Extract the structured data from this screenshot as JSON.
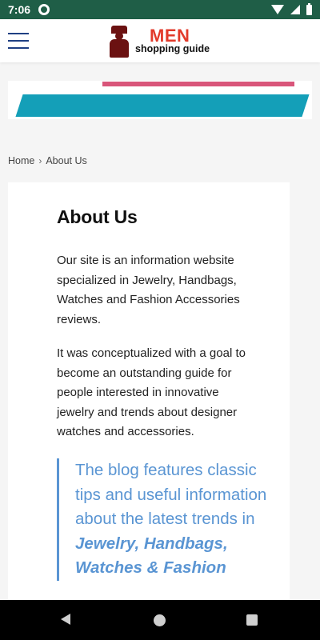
{
  "status_bar": {
    "time": "7:06",
    "icons": [
      "gear-icon",
      "wifi-icon",
      "cell-signal-icon",
      "battery-icon"
    ]
  },
  "header": {
    "logo_title": "MEN",
    "logo_subtitle": "shopping guide",
    "menu_icon": "hamburger-icon"
  },
  "colors": {
    "status_bar": "#1f5e47",
    "banner_pink": "#d9557a",
    "banner_teal": "#149fb8",
    "quote_accent": "#5a95d3",
    "menu_icon": "#1f3f83",
    "logo_red": "#e23a2a"
  },
  "breadcrumb": {
    "home": "Home",
    "separator": "›",
    "current": "About Us"
  },
  "content": {
    "title": "About Us",
    "paragraph1": "Our site is an information website specialized in Jewelry, Handbags, Watches and  Fashion Accessories reviews.",
    "paragraph2": "It was conceptualized with a goal to become an outstanding guide for people interested in innovative jewelry and trends about designer watches and accessories.",
    "quote_text": "The blog features classic tips and useful information about the latest trends in",
    "quote_emphasis": "Jewelry, Handbags, Watches & Fashion"
  },
  "nav_bar": {
    "buttons": [
      "back-icon",
      "home-icon",
      "recents-icon"
    ]
  }
}
